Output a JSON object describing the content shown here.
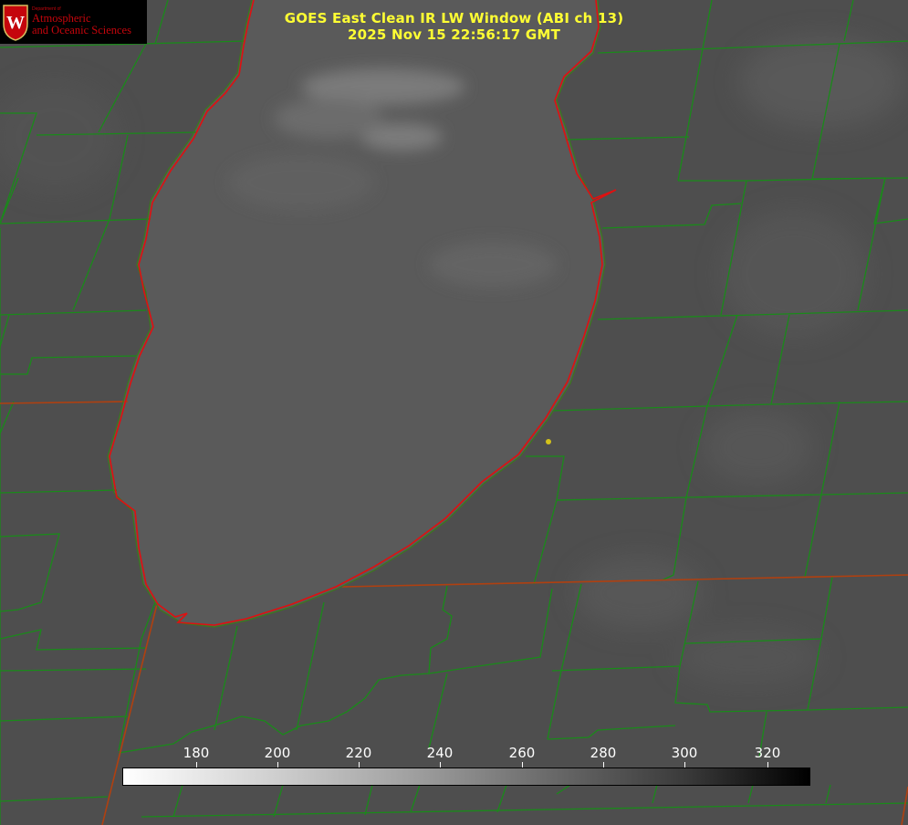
{
  "header": {
    "title_line1": "GOES East Clean IR LW Window (ABI ch 13)",
    "title_line2": "2025 Nov 15 22:56:17 GMT"
  },
  "logo": {
    "dept": "Department of",
    "line1": "Atmospheric",
    "line2": "and Oceanic Sciences",
    "crest_letter": "W"
  },
  "colorbar": {
    "ticks": [
      "180",
      "200",
      "220",
      "240",
      "260",
      "280",
      "300",
      "320"
    ]
  },
  "colors": {
    "title": "#ffff33",
    "county_lines": "#1a8a1a",
    "lake_shore": "#e01010",
    "state_lines": "#b04010",
    "marker": "#d4c21a"
  }
}
